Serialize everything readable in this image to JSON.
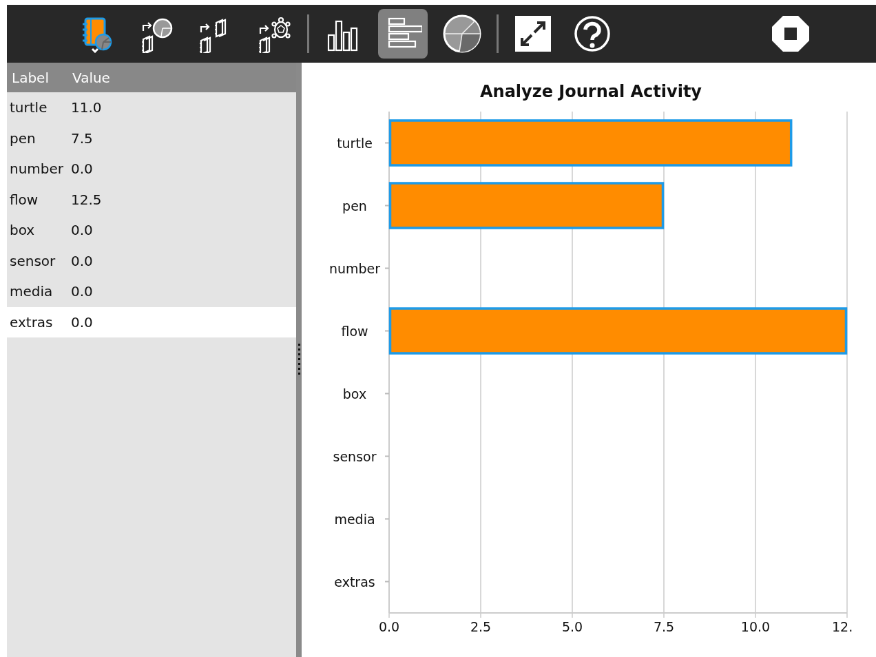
{
  "toolbar": {
    "groups": [
      [
        {
          "kind": "journal",
          "selected": false
        },
        {
          "kind": "export-chart",
          "selected": false
        },
        {
          "kind": "export-data",
          "selected": false
        },
        {
          "kind": "export-turtle",
          "selected": false
        }
      ],
      [
        {
          "kind": "vertical-bars",
          "selected": false
        },
        {
          "kind": "horizontal-bars",
          "selected": true
        },
        {
          "kind": "pie",
          "selected": false
        }
      ],
      [
        {
          "kind": "fullscreen",
          "selected": false
        },
        {
          "kind": "help",
          "selected": false
        }
      ]
    ],
    "end": [
      {
        "kind": "stop",
        "selected": false
      }
    ]
  },
  "table": {
    "columns": [
      "Label",
      "Value"
    ],
    "rows": [
      {
        "label": "turtle",
        "value": "11.0",
        "selected": false
      },
      {
        "label": "pen",
        "value": "7.5",
        "selected": false
      },
      {
        "label": "number",
        "value": "0.0",
        "selected": false
      },
      {
        "label": "flow",
        "value": "12.5",
        "selected": false
      },
      {
        "label": "box",
        "value": "0.0",
        "selected": false
      },
      {
        "label": "sensor",
        "value": "0.0",
        "selected": false
      },
      {
        "label": "media",
        "value": "0.0",
        "selected": false
      },
      {
        "label": "extras",
        "value": "0.0",
        "selected": true
      }
    ]
  },
  "chart": {
    "chart_data": {
      "type": "bar",
      "orientation": "horizontal",
      "title": "Analyze Journal Activity",
      "categories": [
        "turtle",
        "pen",
        "number",
        "flow",
        "box",
        "sensor",
        "media",
        "extras"
      ],
      "values": [
        11.0,
        7.5,
        0.0,
        12.5,
        0.0,
        0.0,
        0.0,
        0.0
      ],
      "xlim": [
        0,
        12.5
      ],
      "grid": true,
      "xticks": [
        {
          "value": 0,
          "label": "0.0"
        },
        {
          "value": 2.5,
          "label": "2.5"
        },
        {
          "value": 5,
          "label": "5.0"
        },
        {
          "value": 7.5,
          "label": "7.5"
        },
        {
          "value": 10,
          "label": "10.0"
        },
        {
          "value": 12.5,
          "label": "12."
        }
      ]
    }
  }
}
